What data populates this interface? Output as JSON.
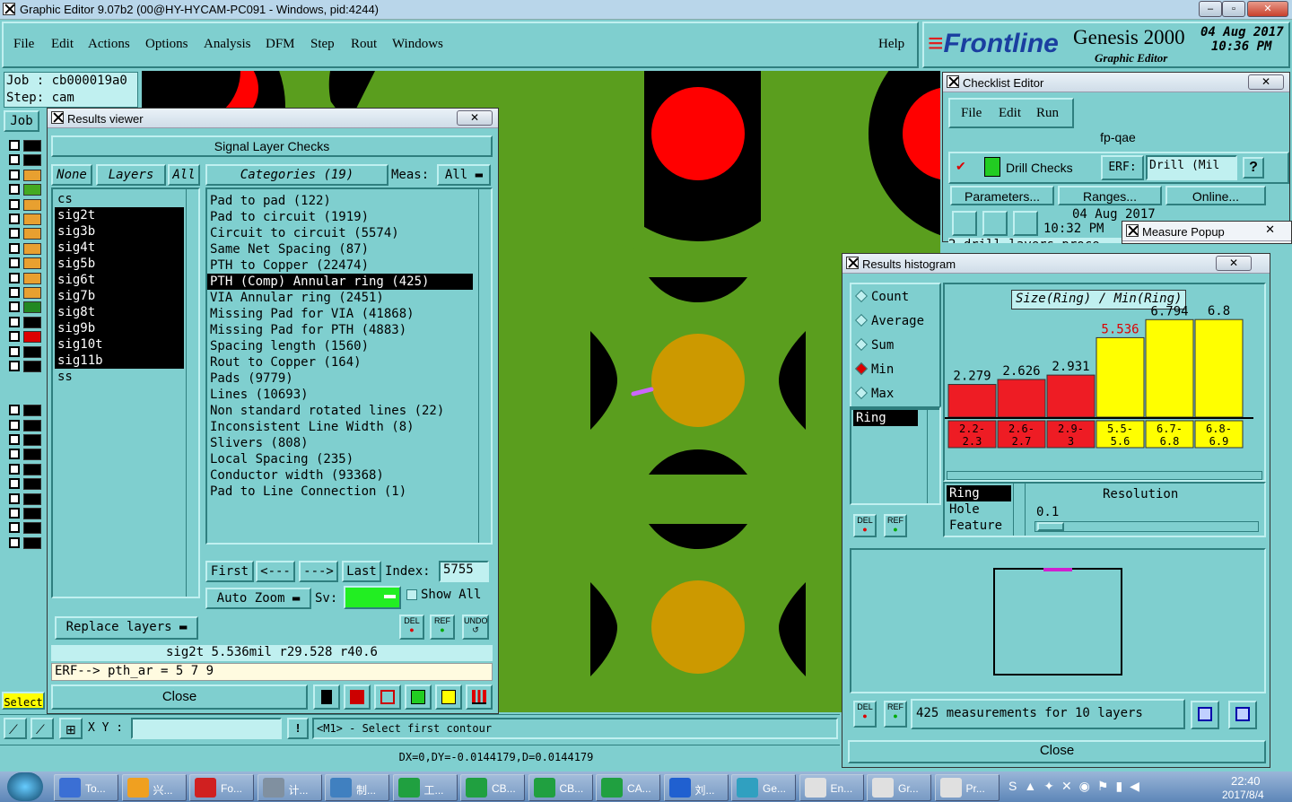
{
  "window": {
    "title": "Graphic Editor 9.07b2 (00@HY-HYCAM-PC091 - Windows, pid:4244)"
  },
  "menubar": {
    "items": [
      "File",
      "Edit",
      "Actions",
      "Options",
      "Analysis",
      "DFM",
      "Step",
      "Rout",
      "Windows"
    ],
    "help": "Help"
  },
  "brand": {
    "logo": "Frontline",
    "product": "Genesis 2000",
    "subtitle": "Graphic Editor",
    "date": "04 Aug 2017",
    "time": "10:36 PM"
  },
  "job": {
    "job_label": "Job  : cb000019a0",
    "step_label": "Step: cam",
    "job_button": "Job",
    "select_button": "Select"
  },
  "results_viewer": {
    "title": "Results viewer",
    "header": "Signal Layer Checks",
    "buttons": {
      "none": "None",
      "layers": "Layers",
      "all": "All"
    },
    "layers": [
      "cs",
      "sig2t",
      "sig3b",
      "sig4t",
      "sig5b",
      "sig6t",
      "sig7b",
      "sig8t",
      "sig9b",
      "sig10t",
      "sig11b",
      "ss"
    ],
    "categories_label": "Categories (19)",
    "meas_label": "Meas:",
    "meas_value": "All",
    "categories": [
      "Pad to pad (122)",
      "Pad to circuit (1919)",
      "Circuit to circuit (5574)",
      "Same Net Spacing (87)",
      "PTH to Copper (22474)",
      "PTH (Comp) Annular ring (425)",
      "VIA Annular ring (2451)",
      "Missing Pad for VIA (41868)",
      "Missing Pad for PTH (4883)",
      "Spacing length (1560)",
      "Rout to Copper (164)",
      "Pads (9779)",
      "Lines (10693)",
      "Non standard rotated lines (22)",
      "Inconsistent Line Width (8)",
      "Slivers (808)",
      "Local Spacing (235)",
      "Conductor width (93368)",
      "Pad to Line Connection (1)"
    ],
    "nav": {
      "first": "First",
      "prev": "<---",
      "next": "--->",
      "last": "Last",
      "index_label": "Index:",
      "index_value": "5755"
    },
    "auto_zoom": "Auto Zoom",
    "sv_label": "Sv:",
    "show_all": "Show All",
    "replace_layers": "Replace layers",
    "del": "DEL",
    "ref": "REF",
    "undo": "UNDO",
    "status": "sig2t 5.536mil  r29.528  r40.6",
    "erf": "ERF--> pth_ar = 5 7 9",
    "close": "Close"
  },
  "checklist": {
    "title": "Checklist Editor",
    "menu": [
      "File",
      "Edit",
      "Run"
    ],
    "name": "fp-qae",
    "check": "Drill Checks",
    "erf_label": "ERF:",
    "erf_value": "Drill (Mil",
    "help": "?",
    "buttons": [
      "Parameters...",
      "Ranges...",
      "Online..."
    ],
    "date": "04 Aug 2017",
    "time": "10:32 PM",
    "log": "2 drill layers proce"
  },
  "measure_popup": {
    "title": "Measure Popup"
  },
  "histogram": {
    "title": "Results histogram",
    "modes": [
      "Count",
      "Average",
      "Sum",
      "Min",
      "Max"
    ],
    "selected_mode": "Min",
    "list": [
      "Ring"
    ],
    "chart_title": "Size(Ring) / Min(Ring)",
    "chart_data": {
      "type": "bar",
      "title": "Size(Ring) / Min(Ring)",
      "categories": [
        "2.2-2.3",
        "2.6-2.7",
        "2.9-3",
        "5.5-5.6",
        "6.7-6.8",
        "6.8-6.9"
      ],
      "values": [
        2.279,
        2.626,
        2.931,
        5.536,
        6.794,
        6.8
      ],
      "value_labels": [
        "2.279",
        "2.626",
        "2.931",
        "5.536",
        "6.794",
        "6.8"
      ],
      "bar_colors": [
        "#ee1c24",
        "#ee1c24",
        "#ee1c24",
        "#ffff00",
        "#ffff00",
        "#ffff00"
      ],
      "range_top": [
        "2.2-",
        "2.6-",
        "2.9-",
        "5.5-",
        "6.7-",
        "6.8-"
      ],
      "range_bottom": [
        "2.3",
        "2.7",
        "3",
        "5.6",
        "6.8",
        "6.9"
      ],
      "ylim": [
        0,
        7
      ]
    },
    "fields": [
      "Ring",
      "Hole",
      "Feature"
    ],
    "resolution_label": "Resolution",
    "resolution_value": "0.1",
    "summary": "425 measurements for 10 layers",
    "close": "Close",
    "del": "DEL",
    "ref": "REF"
  },
  "bottom": {
    "xy_label": "X Y :",
    "prompt": "<M1> - Select first contour",
    "readout": "DX=0,DY=-0.0144179,D=0.0144179"
  },
  "taskbar": {
    "items": [
      "To...",
      "兴...",
      "Fo...",
      "计...",
      "制...",
      "工...",
      "CB...",
      "CB...",
      "CA...",
      "刘...",
      "Ge...",
      "En...",
      "Gr...",
      "Pr..."
    ],
    "clock_time": "22:40",
    "clock_date": "2017/8/4"
  },
  "colors": {
    "bg": "#7fcfcf",
    "copper": "#5a9e1e",
    "pad": "#cc9900",
    "red": "#ff0000"
  }
}
